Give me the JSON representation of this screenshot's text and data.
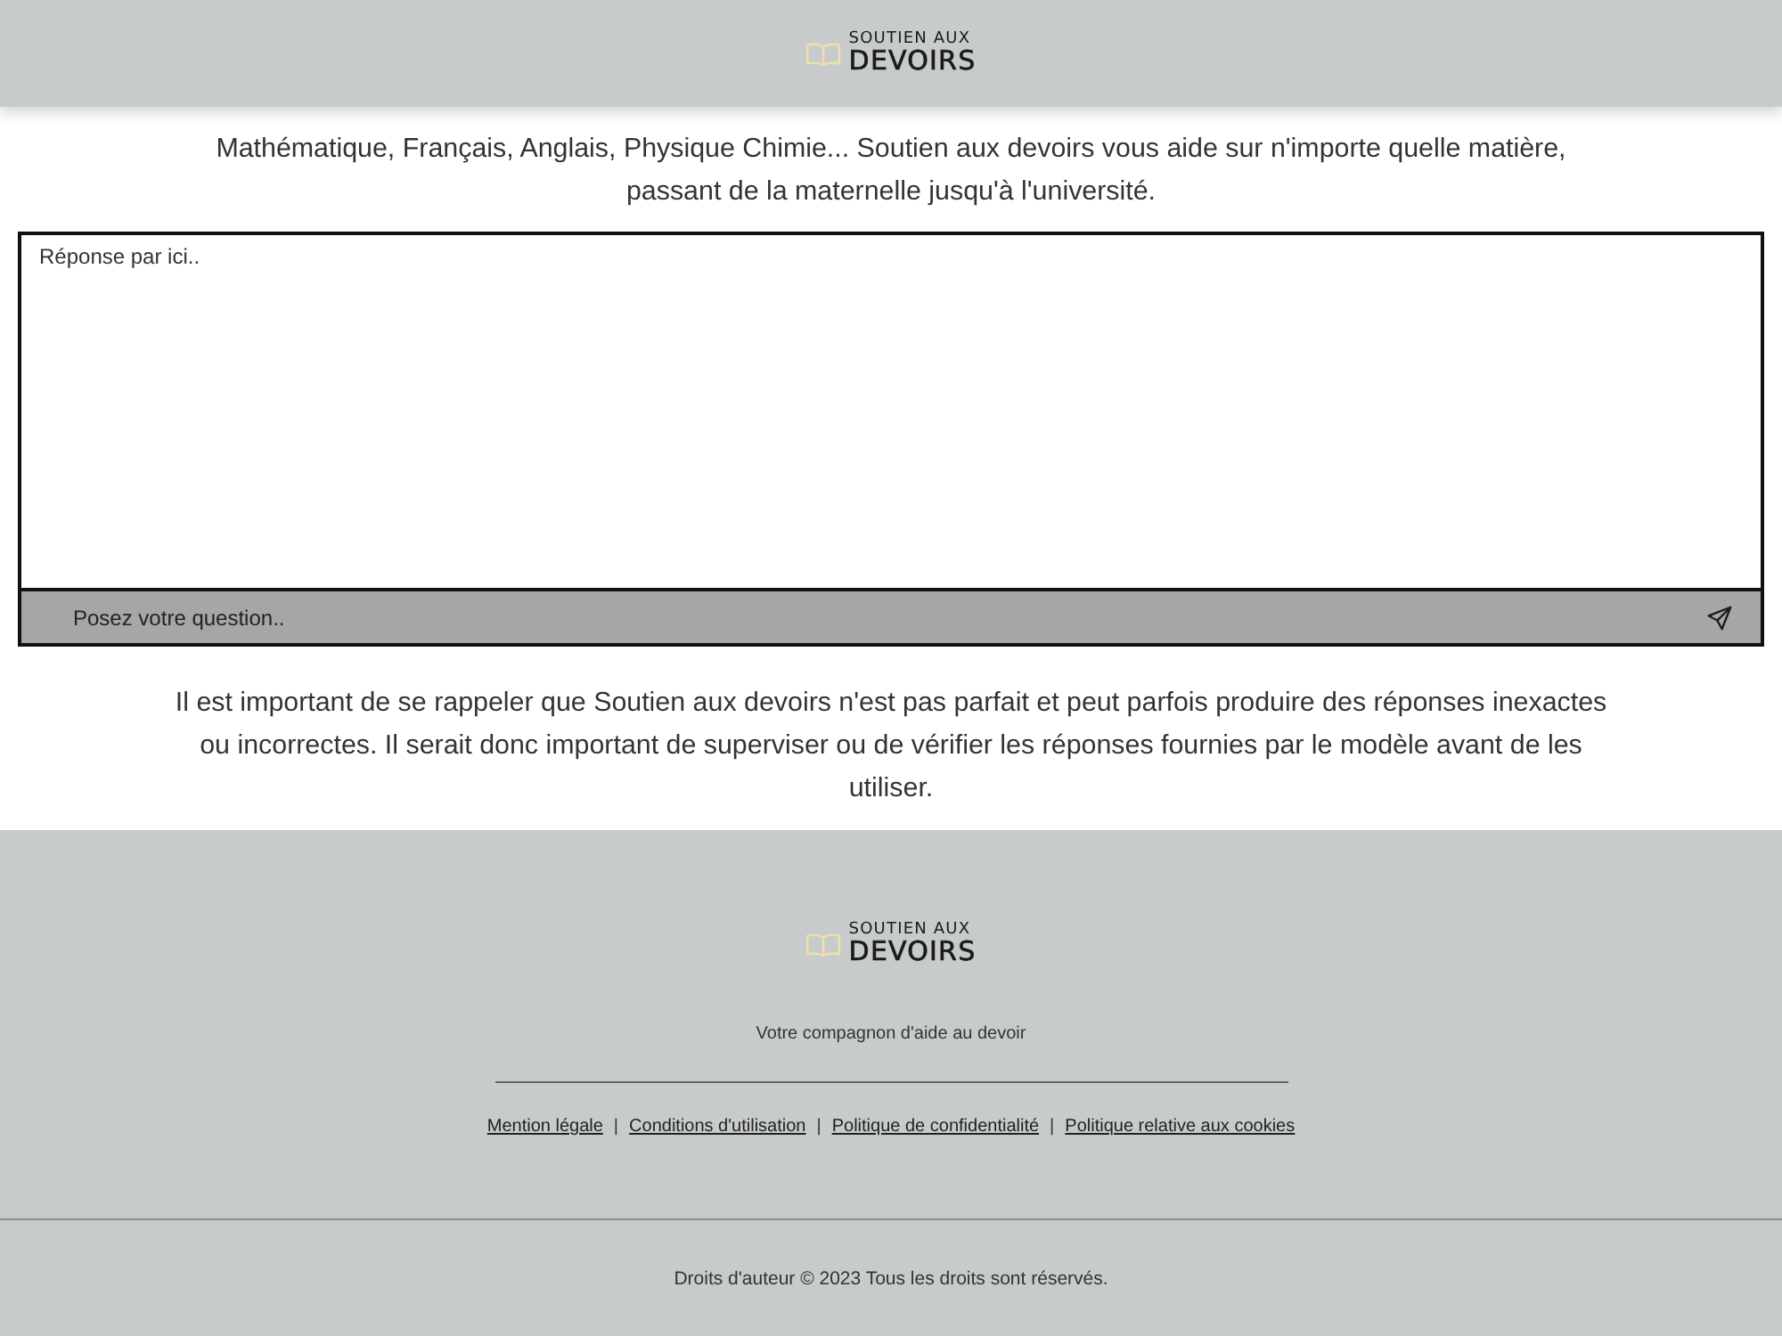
{
  "header": {
    "logo": {
      "line_1": "SOUTIEN AUX",
      "line_2": "DEVOIRS"
    }
  },
  "intro": "Mathématique, Français, Anglais, Physique Chimie... Soutien aux devoirs vous aide sur n'importe quelle matière, passant de la maternelle jusqu'à l'université.",
  "response_box": {
    "placeholder": "Réponse par ici.."
  },
  "question_field": {
    "placeholder": "Posez votre question.."
  },
  "disclaimer": "Il est important de se rappeler que Soutien aux devoirs n'est pas parfait et peut parfois produire des réponses inexactes ou incorrectes. Il serait donc important de superviser ou de vérifier les réponses fournies par le modèle avant de les utiliser.",
  "footer": {
    "logo": {
      "line_1": "SOUTIEN AUX",
      "line_2": "DEVOIRS"
    },
    "tagline": "Votre compagnon d'aide au devoir",
    "links": [
      "Mention légale",
      "Conditions d'utilisation",
      "Politique de confidentialité",
      "Politique relative aux cookies"
    ],
    "link_separator": "|",
    "copyright": "Droits d'auteur © 2023 Tous les droits sont réservés."
  }
}
